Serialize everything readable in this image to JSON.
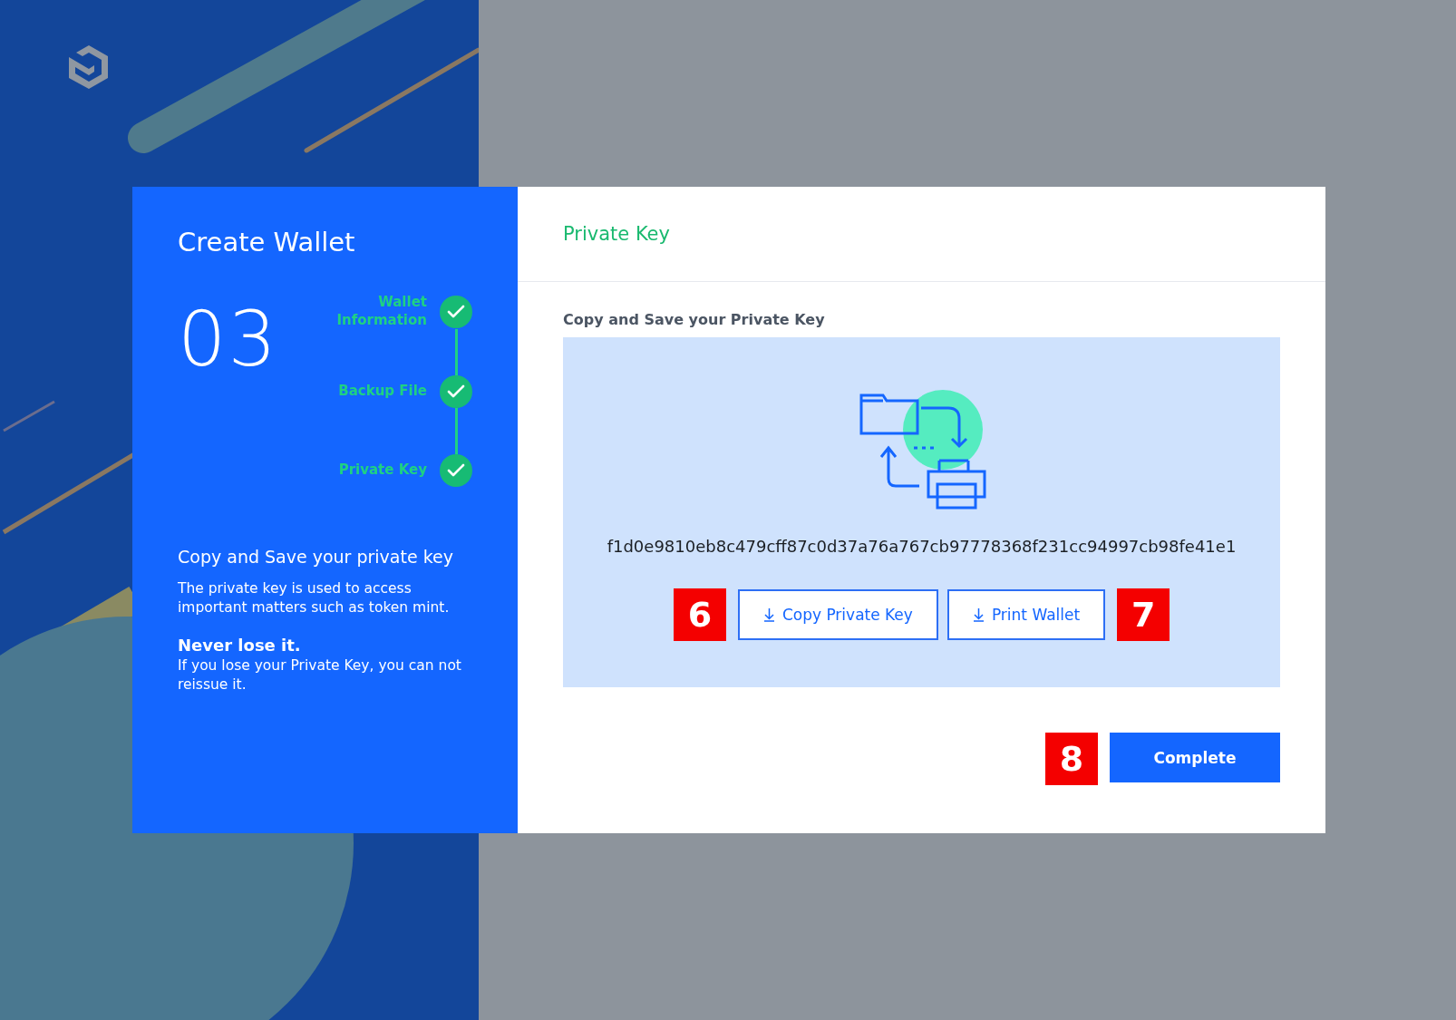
{
  "sidebar": {
    "title": "Create Wallet",
    "step_number": "03",
    "steps": [
      {
        "label": "Wallet Information",
        "done": true
      },
      {
        "label": "Backup File",
        "done": true
      },
      {
        "label": "Private Key",
        "done": true
      }
    ],
    "heading": "Copy and Save your private key",
    "description": "The private key is used to access important matters such as token mint.",
    "warning_title": "Never lose it.",
    "warning_text": "If you lose your Private Key, you can not reissue it."
  },
  "panel": {
    "title": "Private Key",
    "section_label": "Copy and Save your Private Key",
    "private_key": "f1d0e9810eb8c479cff87c0d37a76a767cb97778368f231cc94997cb98fe41e1",
    "actions": [
      {
        "kind": "marker",
        "text": "6"
      },
      {
        "kind": "button",
        "label": "Copy Private Key"
      },
      {
        "kind": "button",
        "label": "Print Wallet"
      },
      {
        "kind": "marker",
        "text": "7"
      }
    ],
    "footer": [
      {
        "kind": "marker",
        "text": "8"
      },
      {
        "kind": "primary",
        "label": "Complete"
      }
    ]
  }
}
